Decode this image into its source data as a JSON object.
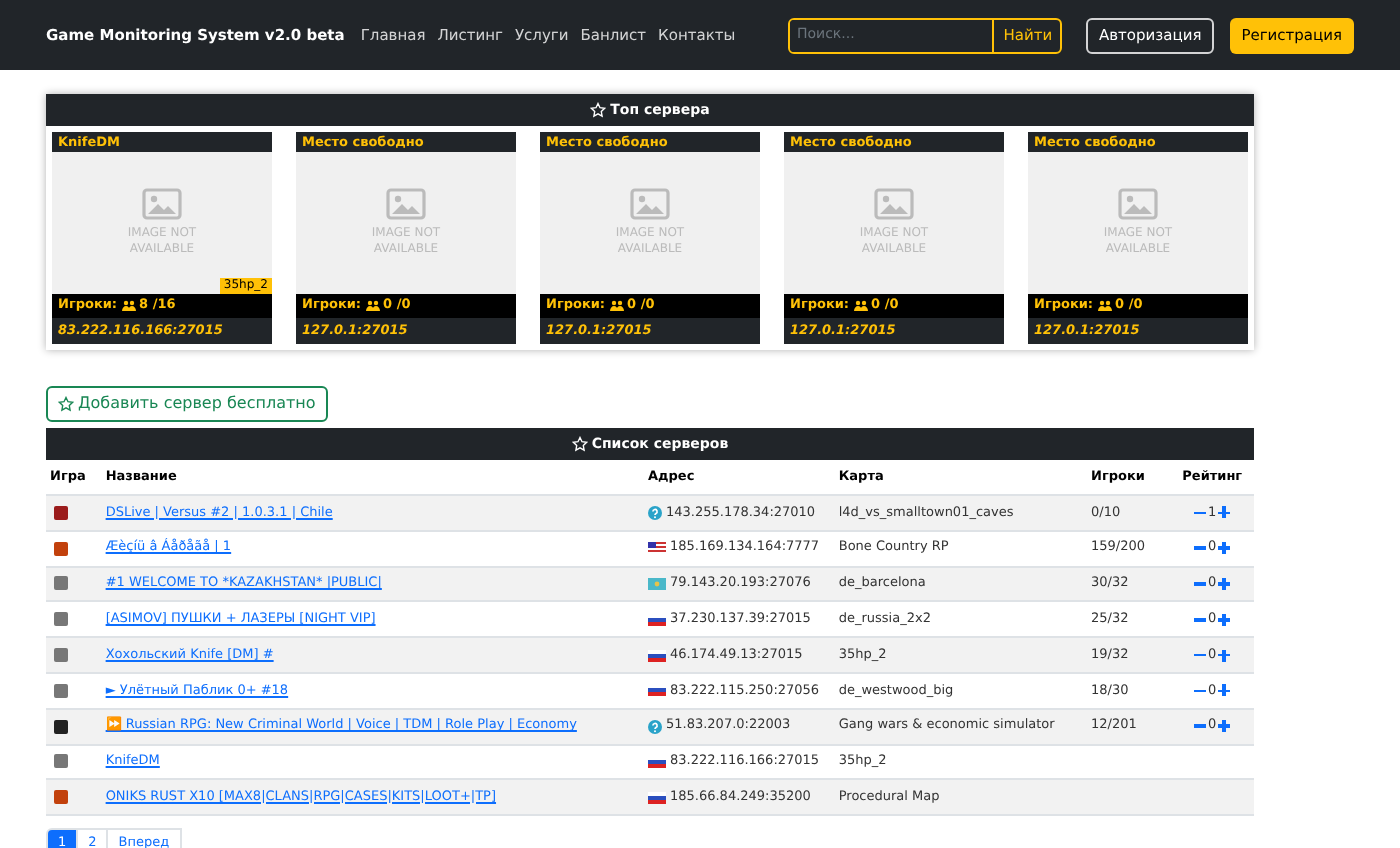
{
  "navbar": {
    "brand": "Game Monitoring System v2.0 beta",
    "links": [
      "Главная",
      "Листинг",
      "Услуги",
      "Банлист",
      "Контакты"
    ],
    "search": {
      "placeholder": "Поиск...",
      "button": "Найти"
    },
    "login": "Авторизация",
    "register": "Регистрация"
  },
  "top_servers": {
    "title": "Топ сервера",
    "cards": [
      {
        "name": "KnifeDM",
        "image_text": "IMAGE NOT AVAILABLE",
        "map": "35hp_2",
        "players_label": "Игроки:",
        "players": "8 /16",
        "address": "83.222.116.166:27015"
      },
      {
        "name": "Место свободно",
        "image_text": "IMAGE NOT AVAILABLE",
        "players_label": "Игроки:",
        "players": "0 /0",
        "address": "127.0.1:27015"
      },
      {
        "name": "Место свободно",
        "image_text": "IMAGE NOT AVAILABLE",
        "players_label": "Игроки:",
        "players": "0 /0",
        "address": "127.0.1:27015"
      },
      {
        "name": "Место свободно",
        "image_text": "IMAGE NOT AVAILABLE",
        "players_label": "Игроки:",
        "players": "0 /0",
        "address": "127.0.1:27015"
      },
      {
        "name": "Место свободно",
        "image_text": "IMAGE NOT AVAILABLE",
        "players_label": "Игроки:",
        "players": "0 /0",
        "address": "127.0.1:27015"
      }
    ]
  },
  "add_server_button": "Добавить сервер бесплатно",
  "server_list": {
    "title": "Список серверов",
    "columns": [
      "Игра",
      "Название",
      "Адрес",
      "Карта",
      "Игроки",
      "Рейтинг"
    ],
    "rows": [
      {
        "game_icon": {
          "kind": "l4d"
        },
        "name": "DSLive | Versus #2 | 1.0.3.1 | Chile",
        "flag": {
          "kind": "unknown"
        },
        "address": "143.255.178.34:27010",
        "map": "l4d_vs_smalltown01_caves",
        "players": "0/10",
        "rating": "1"
      },
      {
        "game_icon": {
          "kind": "rust"
        },
        "name": "Æèçíü â Áåðåãå | 1",
        "flag": {
          "kind": "us"
        },
        "address": "185.169.134.164:7777",
        "map": "Bone Country RP",
        "players": "159/200",
        "rating": "0"
      },
      {
        "game_icon": {
          "kind": "cs"
        },
        "name": "#1 WELCOME TO *KAZAKHSTAN* |PUBLIC|",
        "flag": {
          "kind": "kz"
        },
        "address": "79.143.20.193:27076",
        "map": "de_barcelona",
        "players": "30/32",
        "rating": "0"
      },
      {
        "game_icon": {
          "kind": "cs"
        },
        "name": "[ASIMOV] ПУШКИ + ЛАЗЕРЫ [NIGHT VIP]",
        "flag": {
          "kind": "ru"
        },
        "address": "37.230.137.39:27015",
        "map": "de_russia_2x2",
        "players": "25/32",
        "rating": "0"
      },
      {
        "game_icon": {
          "kind": "cs"
        },
        "name": "Хохольский Knife [DM] #",
        "flag": {
          "kind": "ru"
        },
        "address": "46.174.49.13:27015",
        "map": "35hp_2",
        "players": "19/32",
        "rating": "0"
      },
      {
        "game_icon": {
          "kind": "cs"
        },
        "name": "► Улётный Паблик 0+ #18",
        "flag": {
          "kind": "ru"
        },
        "address": "83.222.115.250:27056",
        "map": "de_westwood_big",
        "players": "18/30",
        "rating": "0"
      },
      {
        "game_icon": {
          "kind": "gmod"
        },
        "name": "⏩ Russian RPG: New Criminal World | Voice | TDM | Role Play | Economy",
        "flag": {
          "kind": "unknown"
        },
        "address": "51.83.207.0:22003",
        "map": "Gang wars & economic simulator",
        "players": "12/201",
        "rating": "0"
      },
      {
        "game_icon": {
          "kind": "cs"
        },
        "name": "KnifeDM",
        "flag": {
          "kind": "ru"
        },
        "address": "83.222.116.166:27015",
        "map": "35hp_2"
      },
      {
        "game_icon": {
          "kind": "rust"
        },
        "name": "ONIKS RUST X10 [MAX8|CLANS|RPG|CASES|KITS|LOOT+|TP]",
        "flag": {
          "kind": "ru"
        },
        "address": "185.66.84.249:35200",
        "map": "Procedural Map"
      }
    ]
  },
  "pagination": [
    {
      "label": "1",
      "selected": true
    },
    {
      "label": "2",
      "selected": false
    },
    {
      "label": "Вперед",
      "selected": false
    }
  ]
}
